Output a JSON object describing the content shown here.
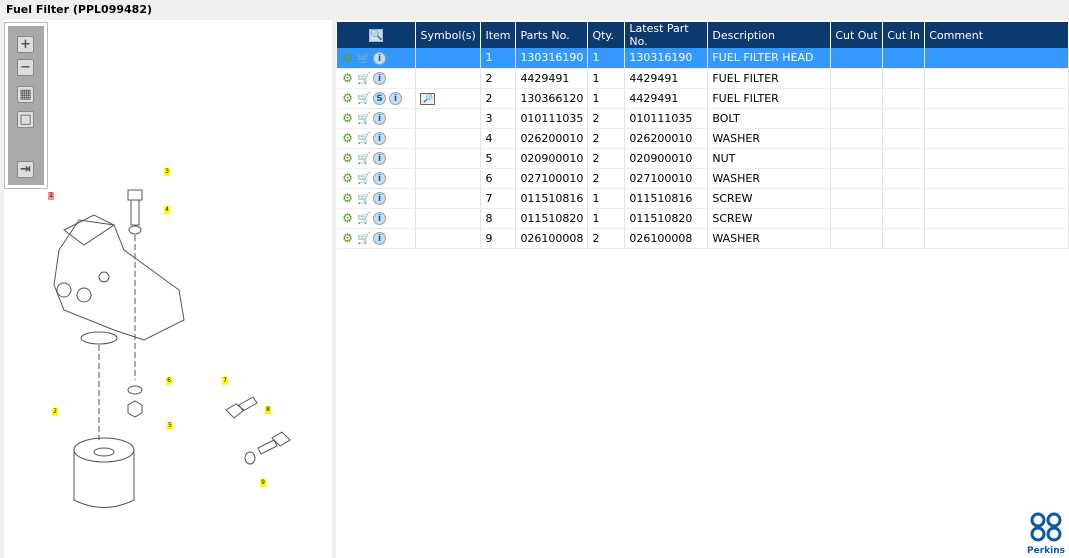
{
  "title": "Fuel Filter (PPL099482)",
  "toolbar": {
    "zoom_in": "+",
    "zoom_out": "−",
    "fit": "▦",
    "actual": "□",
    "export": "⇥"
  },
  "columns": [
    "",
    "Symbol(s)",
    "Item",
    "Parts No.",
    "Qty.",
    "Latest Part No.",
    "Description",
    "Cut Out",
    "Cut In",
    "Comment"
  ],
  "rows": [
    {
      "item": "1",
      "part": "130316190",
      "qty": "1",
      "latest": "130316190",
      "desc": "FUEL FILTER HEAD",
      "selected": true
    },
    {
      "item": "2",
      "part": "4429491",
      "qty": "1",
      "latest": "4429491",
      "desc": "FUEL FILTER"
    },
    {
      "item": "2",
      "part": "130366120",
      "qty": "1",
      "latest": "4429491",
      "desc": "FUEL FILTER",
      "service": "S",
      "symbol": "book"
    },
    {
      "item": "3",
      "part": "010111035",
      "qty": "2",
      "latest": "010111035",
      "desc": "BOLT"
    },
    {
      "item": "4",
      "part": "026200010",
      "qty": "2",
      "latest": "026200010",
      "desc": "WASHER"
    },
    {
      "item": "5",
      "part": "020900010",
      "qty": "2",
      "latest": "020900010",
      "desc": "NUT"
    },
    {
      "item": "6",
      "part": "027100010",
      "qty": "2",
      "latest": "027100010",
      "desc": "WASHER"
    },
    {
      "item": "7",
      "part": "011510816",
      "qty": "1",
      "latest": "011510816",
      "desc": "SCREW"
    },
    {
      "item": "8",
      "part": "011510820",
      "qty": "1",
      "latest": "011510820",
      "desc": "SCREW"
    },
    {
      "item": "9",
      "part": "026100008",
      "qty": "2",
      "latest": "026100008",
      "desc": "WASHER"
    }
  ],
  "callouts": [
    "1",
    "2",
    "3",
    "4",
    "5",
    "6",
    "7",
    "8",
    "9"
  ],
  "brand": "Perkins",
  "colors": {
    "header": "#0d3a6e",
    "selected": "#3399ff"
  }
}
